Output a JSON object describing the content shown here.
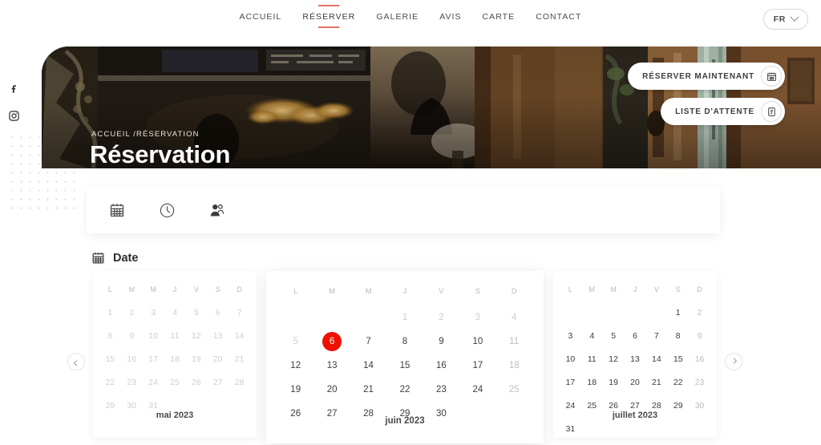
{
  "header": {
    "nav": [
      {
        "label": "ACCUEIL",
        "active": false
      },
      {
        "label": "RÉSERVER",
        "active": true
      },
      {
        "label": "GALERIE",
        "active": false
      },
      {
        "label": "AVIS",
        "active": false
      },
      {
        "label": "CARTE",
        "active": false
      },
      {
        "label": "CONTACT",
        "active": false
      }
    ],
    "language": {
      "value": "FR",
      "icon": "chevron-down-icon"
    }
  },
  "social": [
    {
      "name": "facebook-icon",
      "label": "f"
    },
    {
      "name": "instagram-icon",
      "label": ""
    }
  ],
  "hero": {
    "breadcrumb": "ACCUEIL /RÉSERVATION",
    "title": "Réservation",
    "buttons": [
      {
        "label": "RÉSERVER MAINTENANT",
        "icon": "calendar-icon"
      },
      {
        "label": "LISTE D'ATTENTE",
        "icon": "list-icon"
      }
    ]
  },
  "tabs": [
    {
      "name": "tab-date",
      "icon": "calendar-icon",
      "active": true
    },
    {
      "name": "tab-time",
      "icon": "clock-icon",
      "active": false
    },
    {
      "name": "tab-guests",
      "icon": "people-icon",
      "active": false
    }
  ],
  "section": {
    "icon": "calendar-icon",
    "title": "Date"
  },
  "calendar": {
    "prev_label": "‹",
    "next_label": "›",
    "accent_selected": "#f01000",
    "dow": [
      "L",
      "M",
      "M",
      "J",
      "V",
      "S",
      "D"
    ],
    "months": [
      {
        "label": "mai 2023",
        "lead_blanks": 0,
        "days": [
          {
            "n": "1",
            "state": "dim"
          },
          {
            "n": "2",
            "state": "dim"
          },
          {
            "n": "3",
            "state": "dim"
          },
          {
            "n": "4",
            "state": "dim"
          },
          {
            "n": "5",
            "state": "dim"
          },
          {
            "n": "6",
            "state": "dim"
          },
          {
            "n": "7",
            "state": "dim"
          },
          {
            "n": "8",
            "state": "dim"
          },
          {
            "n": "9",
            "state": "dim"
          },
          {
            "n": "10",
            "state": "dim"
          },
          {
            "n": "11",
            "state": "dim"
          },
          {
            "n": "12",
            "state": "dim"
          },
          {
            "n": "13",
            "state": "dim"
          },
          {
            "n": "14",
            "state": "dim"
          },
          {
            "n": "15",
            "state": "dim"
          },
          {
            "n": "16",
            "state": "dim"
          },
          {
            "n": "17",
            "state": "dim"
          },
          {
            "n": "18",
            "state": "dim"
          },
          {
            "n": "19",
            "state": "dim"
          },
          {
            "n": "20",
            "state": "dim"
          },
          {
            "n": "21",
            "state": "dim"
          },
          {
            "n": "22",
            "state": "dim"
          },
          {
            "n": "23",
            "state": "dim"
          },
          {
            "n": "24",
            "state": "dim"
          },
          {
            "n": "25",
            "state": "dim"
          },
          {
            "n": "26",
            "state": "dim"
          },
          {
            "n": "27",
            "state": "dim"
          },
          {
            "n": "28",
            "state": "dim"
          },
          {
            "n": "29",
            "state": "dim"
          },
          {
            "n": "30",
            "state": "dim"
          },
          {
            "n": "31",
            "state": "dim"
          }
        ]
      },
      {
        "label": "juin 2023",
        "lead_blanks": 3,
        "days": [
          {
            "n": "1",
            "state": "dim"
          },
          {
            "n": "2",
            "state": "dim"
          },
          {
            "n": "3",
            "state": "dim"
          },
          {
            "n": "4",
            "state": "dim"
          },
          {
            "n": "5",
            "state": "dim"
          },
          {
            "n": "6",
            "state": "sel"
          },
          {
            "n": "7",
            "state": "on"
          },
          {
            "n": "8",
            "state": "on"
          },
          {
            "n": "9",
            "state": "on"
          },
          {
            "n": "10",
            "state": "on"
          },
          {
            "n": "11",
            "state": "off"
          },
          {
            "n": "12",
            "state": "on"
          },
          {
            "n": "13",
            "state": "on"
          },
          {
            "n": "14",
            "state": "on"
          },
          {
            "n": "15",
            "state": "on"
          },
          {
            "n": "16",
            "state": "on"
          },
          {
            "n": "17",
            "state": "on"
          },
          {
            "n": "18",
            "state": "off"
          },
          {
            "n": "19",
            "state": "on"
          },
          {
            "n": "20",
            "state": "on"
          },
          {
            "n": "21",
            "state": "on"
          },
          {
            "n": "22",
            "state": "on"
          },
          {
            "n": "23",
            "state": "on"
          },
          {
            "n": "24",
            "state": "on"
          },
          {
            "n": "25",
            "state": "off"
          },
          {
            "n": "26",
            "state": "on"
          },
          {
            "n": "27",
            "state": "on"
          },
          {
            "n": "28",
            "state": "on"
          },
          {
            "n": "29",
            "state": "on"
          },
          {
            "n": "30",
            "state": "on"
          }
        ]
      },
      {
        "label": "juillet 2023",
        "lead_blanks": 5,
        "days": [
          {
            "n": "1",
            "state": "on"
          },
          {
            "n": "2",
            "state": "off"
          },
          {
            "n": "3",
            "state": "on"
          },
          {
            "n": "4",
            "state": "on"
          },
          {
            "n": "5",
            "state": "on"
          },
          {
            "n": "6",
            "state": "on"
          },
          {
            "n": "7",
            "state": "on"
          },
          {
            "n": "8",
            "state": "on"
          },
          {
            "n": "9",
            "state": "off"
          },
          {
            "n": "10",
            "state": "on"
          },
          {
            "n": "11",
            "state": "on"
          },
          {
            "n": "12",
            "state": "on"
          },
          {
            "n": "13",
            "state": "on"
          },
          {
            "n": "14",
            "state": "on"
          },
          {
            "n": "15",
            "state": "on"
          },
          {
            "n": "16",
            "state": "off"
          },
          {
            "n": "17",
            "state": "on"
          },
          {
            "n": "18",
            "state": "on"
          },
          {
            "n": "19",
            "state": "on"
          },
          {
            "n": "20",
            "state": "on"
          },
          {
            "n": "21",
            "state": "on"
          },
          {
            "n": "22",
            "state": "on"
          },
          {
            "n": "23",
            "state": "off"
          },
          {
            "n": "24",
            "state": "on"
          },
          {
            "n": "25",
            "state": "on"
          },
          {
            "n": "26",
            "state": "on"
          },
          {
            "n": "27",
            "state": "on"
          },
          {
            "n": "28",
            "state": "on"
          },
          {
            "n": "29",
            "state": "on"
          },
          {
            "n": "30",
            "state": "off"
          },
          {
            "n": "31",
            "state": "on"
          }
        ]
      }
    ]
  }
}
